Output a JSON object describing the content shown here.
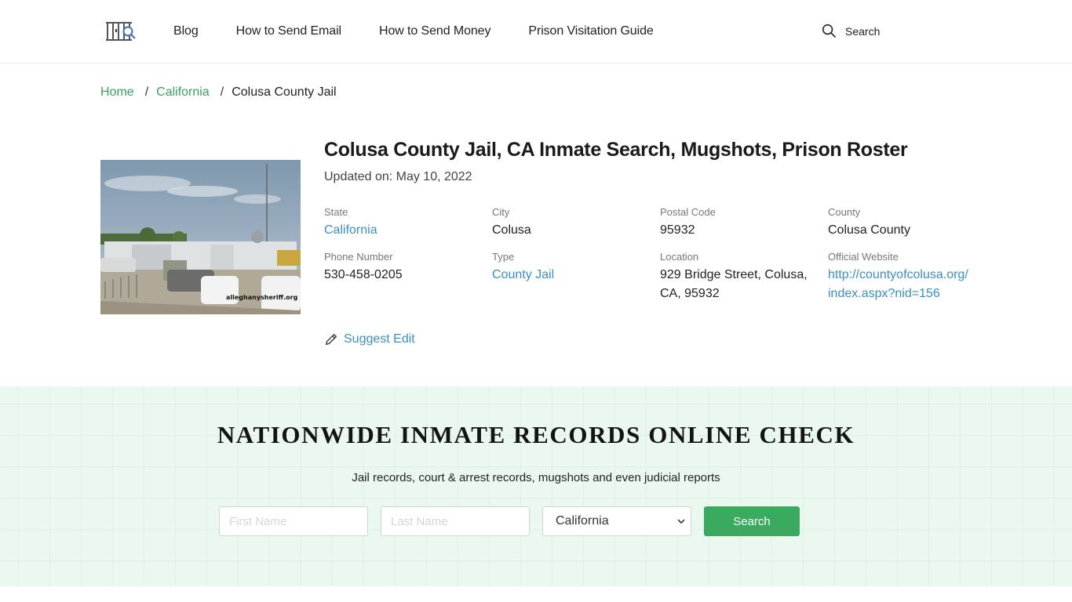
{
  "header": {
    "logo": "jail-bars-search-logo",
    "nav": [
      {
        "label": "Blog"
      },
      {
        "label": "How to Send Email"
      },
      {
        "label": "How to Send Money"
      },
      {
        "label": "Prison Visitation Guide"
      }
    ],
    "search_label": "Search"
  },
  "breadcrumb": {
    "home": "Home",
    "state": "California",
    "current": "Colusa County Jail",
    "separator": "/"
  },
  "facility": {
    "title": "Colusa County Jail, CA Inmate Search, Mugshots, Prison Roster",
    "updated": "Updated on: May 10, 2022",
    "photo_watermark": "alleghanysheriff.org",
    "fields": [
      {
        "label": "State",
        "value": "California",
        "link": true
      },
      {
        "label": "City",
        "value": "Colusa",
        "link": false
      },
      {
        "label": "Postal Code",
        "value": "95932",
        "link": false
      },
      {
        "label": "County",
        "value": "Colusa County",
        "link": false
      },
      {
        "label": "Phone Number",
        "value": "530-458-0205",
        "link": false
      },
      {
        "label": "Type",
        "value": "County Jail",
        "link": true
      },
      {
        "label": "Location",
        "value": "929 Bridge Street, Colusa, CA, 95932",
        "link": false
      },
      {
        "label": "Official Website",
        "value": "http://countyofcolusa.org/ index.aspx?nid=156",
        "link": true
      }
    ],
    "suggest_edit": "Suggest Edit"
  },
  "search_band": {
    "title": "NATIONWIDE INMATE RECORDS ONLINE CHECK",
    "subtitle": "Jail records, court & arrest records, mugshots and even judicial reports",
    "first_name_placeholder": "First Name",
    "first_name_value": "",
    "last_name_placeholder": "Last Name",
    "last_name_value": "",
    "state_selected": "California",
    "button_label": "Search"
  },
  "colors": {
    "accent_green": "#3aaa5e",
    "breadcrumb_link": "#3a9e60",
    "info_link": "#3a8fc4",
    "band_bg": "#eaf8f0"
  }
}
